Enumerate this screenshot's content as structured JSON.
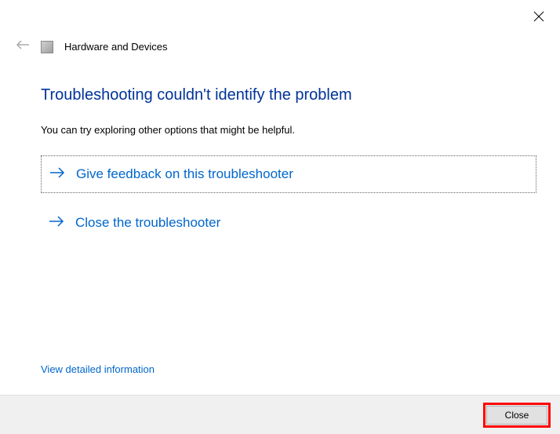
{
  "window": {
    "closeX": "×"
  },
  "header": {
    "title": "Hardware and Devices"
  },
  "content": {
    "heading": "Troubleshooting couldn't identify the problem",
    "subtext": "You can try exploring other options that might be helpful.",
    "options": [
      {
        "label": "Give feedback on this troubleshooter"
      },
      {
        "label": "Close the troubleshooter"
      }
    ],
    "detailLink": "View detailed information"
  },
  "footer": {
    "closeButton": "Close"
  },
  "colors": {
    "linkBlue": "#0066cc",
    "headingBlue": "#003399",
    "highlightRed": "#ff0000"
  }
}
